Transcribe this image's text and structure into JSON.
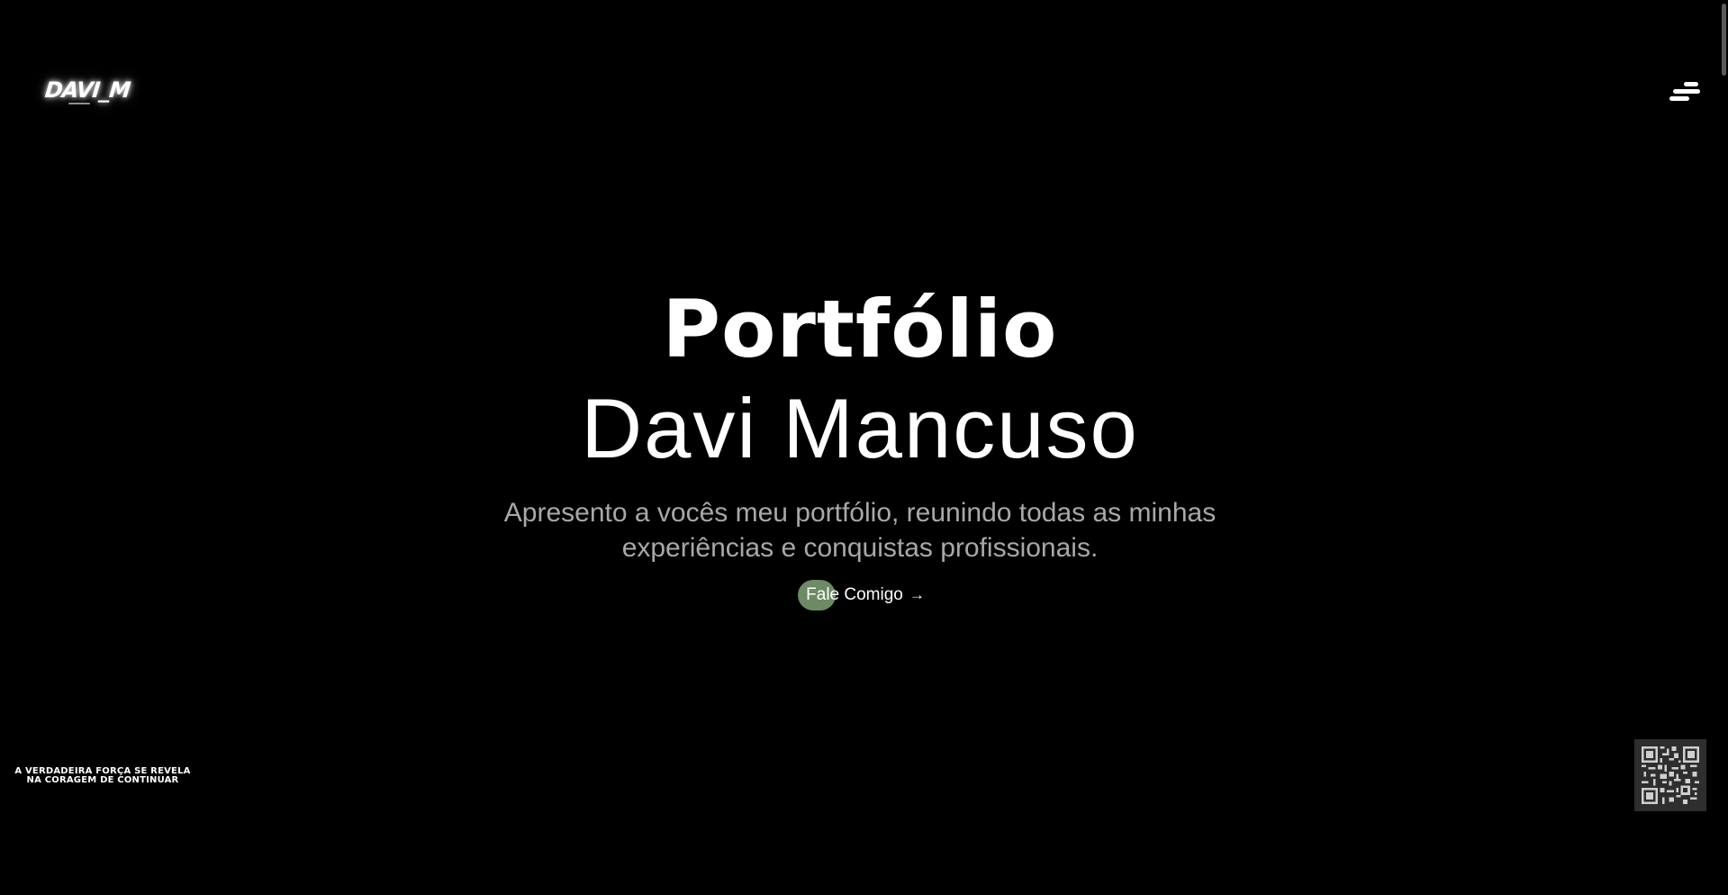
{
  "header": {
    "logo_text": "DAVI_M",
    "menu_icon": "hamburger-menu-icon"
  },
  "hero": {
    "title": "Portfólio",
    "name": "Davi Mancuso",
    "description": "Apresento a vocês meu portfólio, reunindo todas as minhas experiências e conquistas profissionais.",
    "cta_label": "Fale Comigo",
    "cta_icon": "arrow-right-icon",
    "cta_arrow": "→",
    "cta_accent_color": "#6d8a64"
  },
  "footer": {
    "quote_line1": "A VERDADEIRA FORÇA SE REVELA",
    "quote_line2": "NA CORAGEM DE CONTINUAR",
    "qr_icon": "qr-code-icon"
  },
  "colors": {
    "background": "#000000",
    "text": "#ffffff",
    "muted_text": "#a8a8a8"
  }
}
